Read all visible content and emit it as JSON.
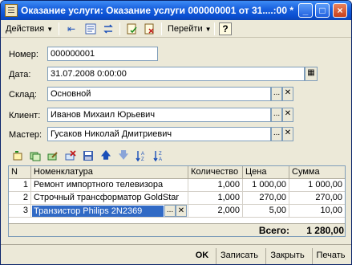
{
  "window": {
    "title": "Оказание услуги: Оказание услуги 000000001 от 31....:00 *"
  },
  "toolbar": {
    "actions_label": "Действия",
    "goto_label": "Перейти",
    "help_label": "?"
  },
  "form": {
    "number_label": "Номер:",
    "number_value": "000000001",
    "date_label": "Дата:",
    "date_value": "31.07.2008  0:00:00",
    "warehouse_label": "Склад:",
    "warehouse_value": "Основной",
    "client_label": "Клиент:",
    "client_value": "Иванов Михаил Юрьевич",
    "master_label": "Мастер:",
    "master_value": "Гусаков Николай Дмитриевич"
  },
  "table": {
    "columns": [
      "N",
      "Номенклатура",
      "Количество",
      "Цена",
      "Сумма"
    ],
    "rows": [
      {
        "n": "1",
        "item": "Ремонт импортного телевизора",
        "qty": "1,000",
        "price": "1 000,00",
        "sum": "1 000,00"
      },
      {
        "n": "2",
        "item": "Строчный трансформатор GoldStar",
        "qty": "1,000",
        "price": "270,00",
        "sum": "270,00"
      },
      {
        "n": "3",
        "item": "Транзистор Philips 2N2369",
        "qty": "2,000",
        "price": "5,00",
        "sum": "10,00"
      }
    ],
    "total_label": "Всего:",
    "total_value": "1 280,00"
  },
  "bottom": {
    "ok_label": "OK",
    "save_label": "Записать",
    "close_label": "Закрыть",
    "print_label": "Печать"
  },
  "icons": {
    "ellipsis": "...",
    "clear": "✕"
  }
}
